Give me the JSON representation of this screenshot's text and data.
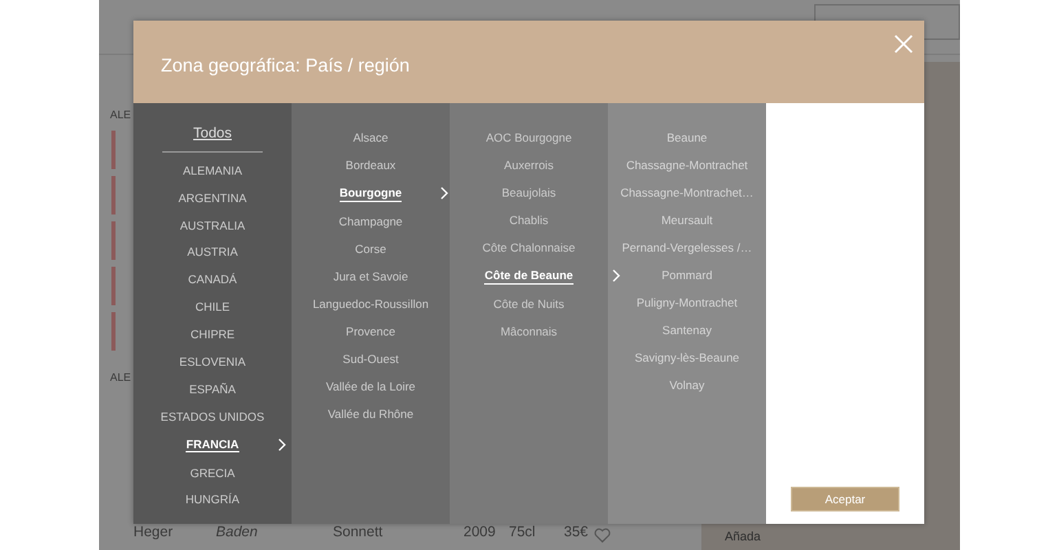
{
  "background_page": {
    "section_labels": [
      "ALE",
      "ALE"
    ],
    "bottom_row": {
      "producer": "Heger",
      "region": "Baden",
      "wine": "Sonnett",
      "vintage": "2009",
      "size": "75cl",
      "price": "35€"
    },
    "side_label": "Añada"
  },
  "modal": {
    "title": "Zona geográfica: País / región",
    "all_label": "Todos",
    "columns": [
      {
        "items": [
          {
            "label": "ALEMANIA",
            "selected": false
          },
          {
            "label": "ARGENTINA",
            "selected": false
          },
          {
            "label": "AUSTRALIA",
            "selected": false
          },
          {
            "label": "AUSTRIA",
            "selected": false
          },
          {
            "label": "CANADÁ",
            "selected": false
          },
          {
            "label": "CHILE",
            "selected": false
          },
          {
            "label": "CHIPRE",
            "selected": false
          },
          {
            "label": "ESLOVENIA",
            "selected": false
          },
          {
            "label": "ESPAÑA",
            "selected": false
          },
          {
            "label": "ESTADOS UNIDOS",
            "selected": false
          },
          {
            "label": "FRANCIA",
            "selected": true
          },
          {
            "label": "GRECIA",
            "selected": false
          },
          {
            "label": "HUNGRÍA",
            "selected": false
          }
        ]
      },
      {
        "items": [
          {
            "label": "Alsace",
            "selected": false
          },
          {
            "label": "Bordeaux",
            "selected": false
          },
          {
            "label": "Bourgogne",
            "selected": true
          },
          {
            "label": "Champagne",
            "selected": false
          },
          {
            "label": "Corse",
            "selected": false
          },
          {
            "label": "Jura et Savoie",
            "selected": false
          },
          {
            "label": "Languedoc-Roussillon",
            "selected": false
          },
          {
            "label": "Provence",
            "selected": false
          },
          {
            "label": "Sud-Ouest",
            "selected": false
          },
          {
            "label": "Vallée de la Loire",
            "selected": false
          },
          {
            "label": "Vallée du Rhône",
            "selected": false
          }
        ]
      },
      {
        "items": [
          {
            "label": "AOC Bourgogne",
            "selected": false
          },
          {
            "label": "Auxerrois",
            "selected": false
          },
          {
            "label": "Beaujolais",
            "selected": false
          },
          {
            "label": "Chablis",
            "selected": false
          },
          {
            "label": "Côte Chalonnaise",
            "selected": false
          },
          {
            "label": "Côte de Beaune",
            "selected": true
          },
          {
            "label": "Côte de Nuits",
            "selected": false
          },
          {
            "label": "Mâconnais",
            "selected": false
          }
        ]
      },
      {
        "items": [
          {
            "label": "Beaune",
            "selected": false
          },
          {
            "label": "Chassagne-Montrachet",
            "selected": false
          },
          {
            "label": "Chassagne-Montrachet…",
            "selected": false
          },
          {
            "label": "Meursault",
            "selected": false
          },
          {
            "label": "Pernand-Vergelesses /…",
            "selected": false
          },
          {
            "label": "Pommard",
            "selected": false
          },
          {
            "label": "Puligny-Montrachet",
            "selected": false
          },
          {
            "label": "Santenay",
            "selected": false
          },
          {
            "label": "Savigny-lès-Beaune",
            "selected": false
          },
          {
            "label": "Volnay",
            "selected": false
          }
        ]
      }
    ],
    "accept_button": "Aceptar"
  }
}
